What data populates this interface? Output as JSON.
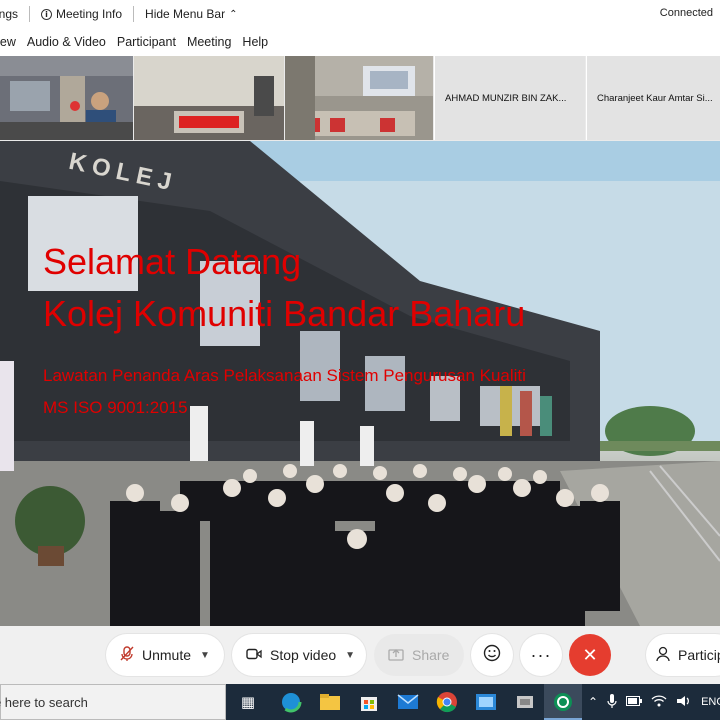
{
  "infobar": {
    "settings_label": "Settings",
    "meeting_info_label": "Meeting Info",
    "hide_menu_label": "Hide Menu Bar",
    "status": "Connected"
  },
  "menu": {
    "items": [
      "View",
      "Audio & Video",
      "Participant",
      "Meeting",
      "Help"
    ]
  },
  "participants": {
    "names": [
      "AHMAD MUNZIR BIN ZAK...",
      "Charanjeet Kaur Amtar Si..."
    ]
  },
  "slide": {
    "title_line1": "Selamat Datang",
    "title_line2": "Kolej Komuniti Bandar Baharu",
    "subtitle_line1": "Lawatan Penanda Aras Pelaksanaan Sistem Pengurusan Kualiti",
    "subtitle_line2": "MS ISO 9001:2015",
    "building_sign": "KOLEJ"
  },
  "controls": {
    "unmute_label": "Unmute",
    "stop_video_label": "Stop video",
    "share_label": "Share",
    "participants_label": "Participants"
  },
  "taskbar": {
    "search_placeholder": "Type here to search",
    "language": "ENG"
  },
  "colors": {
    "slide_text": "#e00000",
    "leave_button": "#e53d2f",
    "taskbar": "#1c2b3b"
  }
}
